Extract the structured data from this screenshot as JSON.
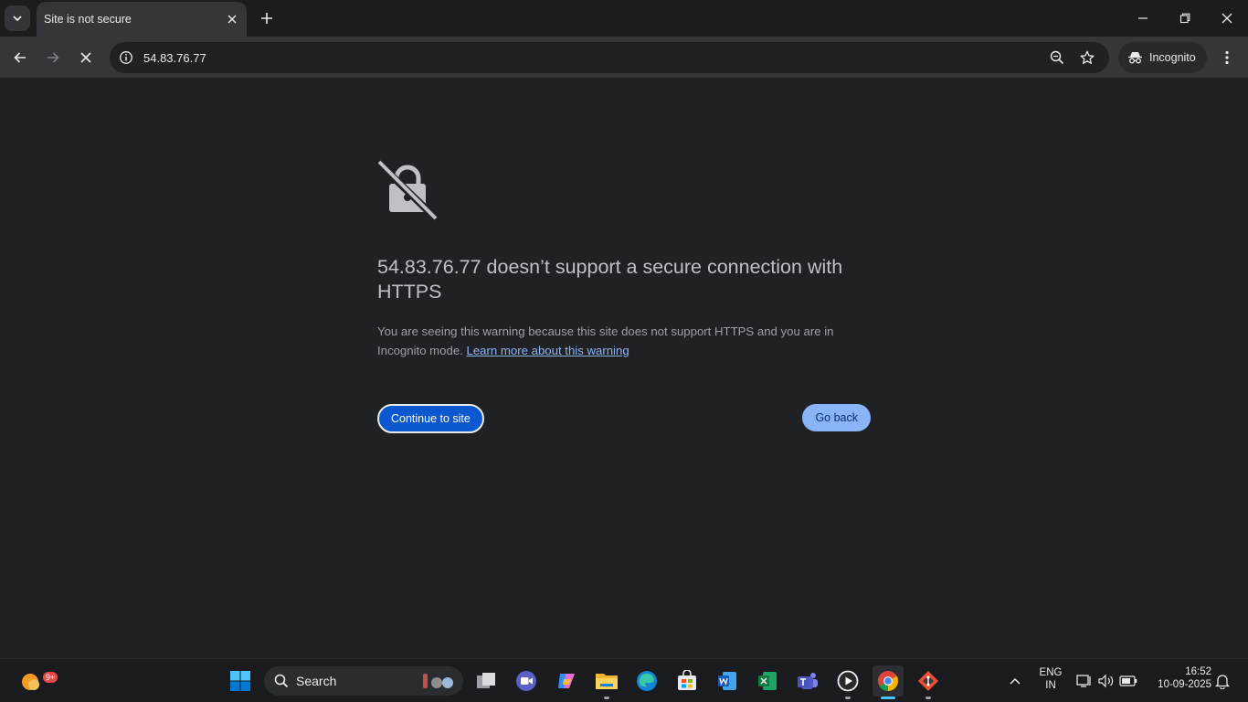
{
  "browser": {
    "tab_title": "Site is not secure",
    "url": "54.83.76.77",
    "incognito_label": "Incognito"
  },
  "page": {
    "heading": "54.83.76.77 doesn’t support a secure connection with HTTPS",
    "explanation": "You are seeing this warning because this site does not support HTTPS and you are in Incognito mode.",
    "learn_more_link": "Learn more about this warning",
    "continue_button": "Continue to site",
    "back_button": "Go back"
  },
  "taskbar": {
    "search_label": "Search",
    "weather_badge": "9+",
    "language": "ENG",
    "region": "IN",
    "time": "16:52",
    "date": "10-09-2025"
  },
  "colors": {
    "page_background": "#202124",
    "continue_button": "#0b57d0",
    "back_button": "#8ab4f8",
    "link": "#8ab4f8"
  }
}
